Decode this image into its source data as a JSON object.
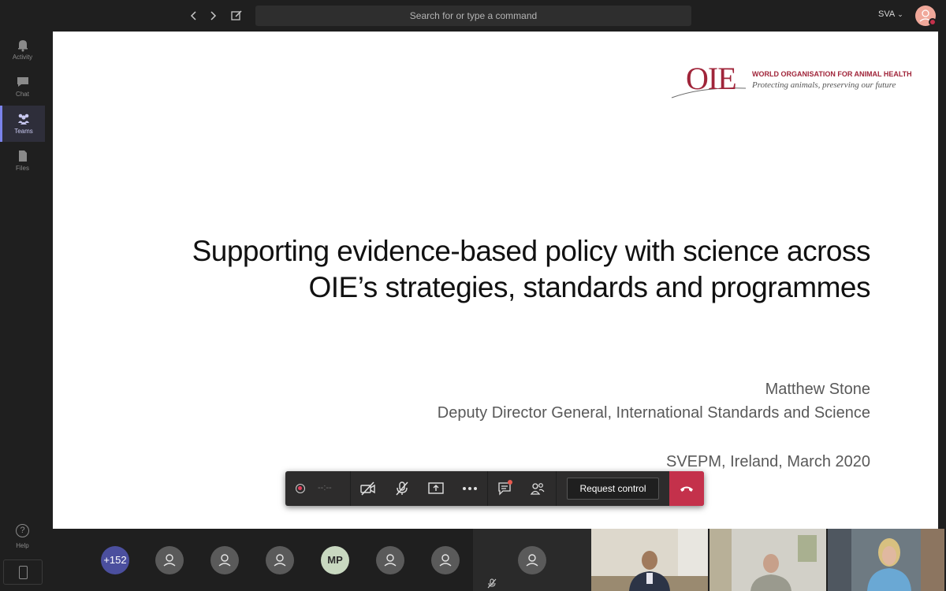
{
  "topbar": {
    "search_placeholder": "Search for or type a command",
    "org_label": "SVA"
  },
  "rail": {
    "items": [
      {
        "label": "Activity",
        "icon": "bell-icon"
      },
      {
        "label": "Chat",
        "icon": "chat-icon"
      },
      {
        "label": "Teams",
        "icon": "teams-icon",
        "active": true
      },
      {
        "label": "Files",
        "icon": "file-icon"
      }
    ],
    "help_label": "Help"
  },
  "slide": {
    "logo": {
      "mark": "OIE",
      "org_name": "WORLD ORGANISATION FOR ANIMAL HEALTH",
      "tagline": "Protecting animals, preserving our future"
    },
    "title_line1": "Supporting evidence-based policy with science across",
    "title_line2": "OIE’s strategies, standards and programmes",
    "presenter": "Matthew Stone",
    "role": "Deputy Director General, International Standards and Science",
    "event": "SVEPM, Ireland, March 2020"
  },
  "callbar": {
    "timer": "--:--",
    "request_control_label": "Request control"
  },
  "participants": {
    "more_count": "+152",
    "initials": "MP"
  },
  "colors": {
    "accent": "#7b83eb",
    "hangup": "#c4314b",
    "oie_red": "#a0253a"
  }
}
